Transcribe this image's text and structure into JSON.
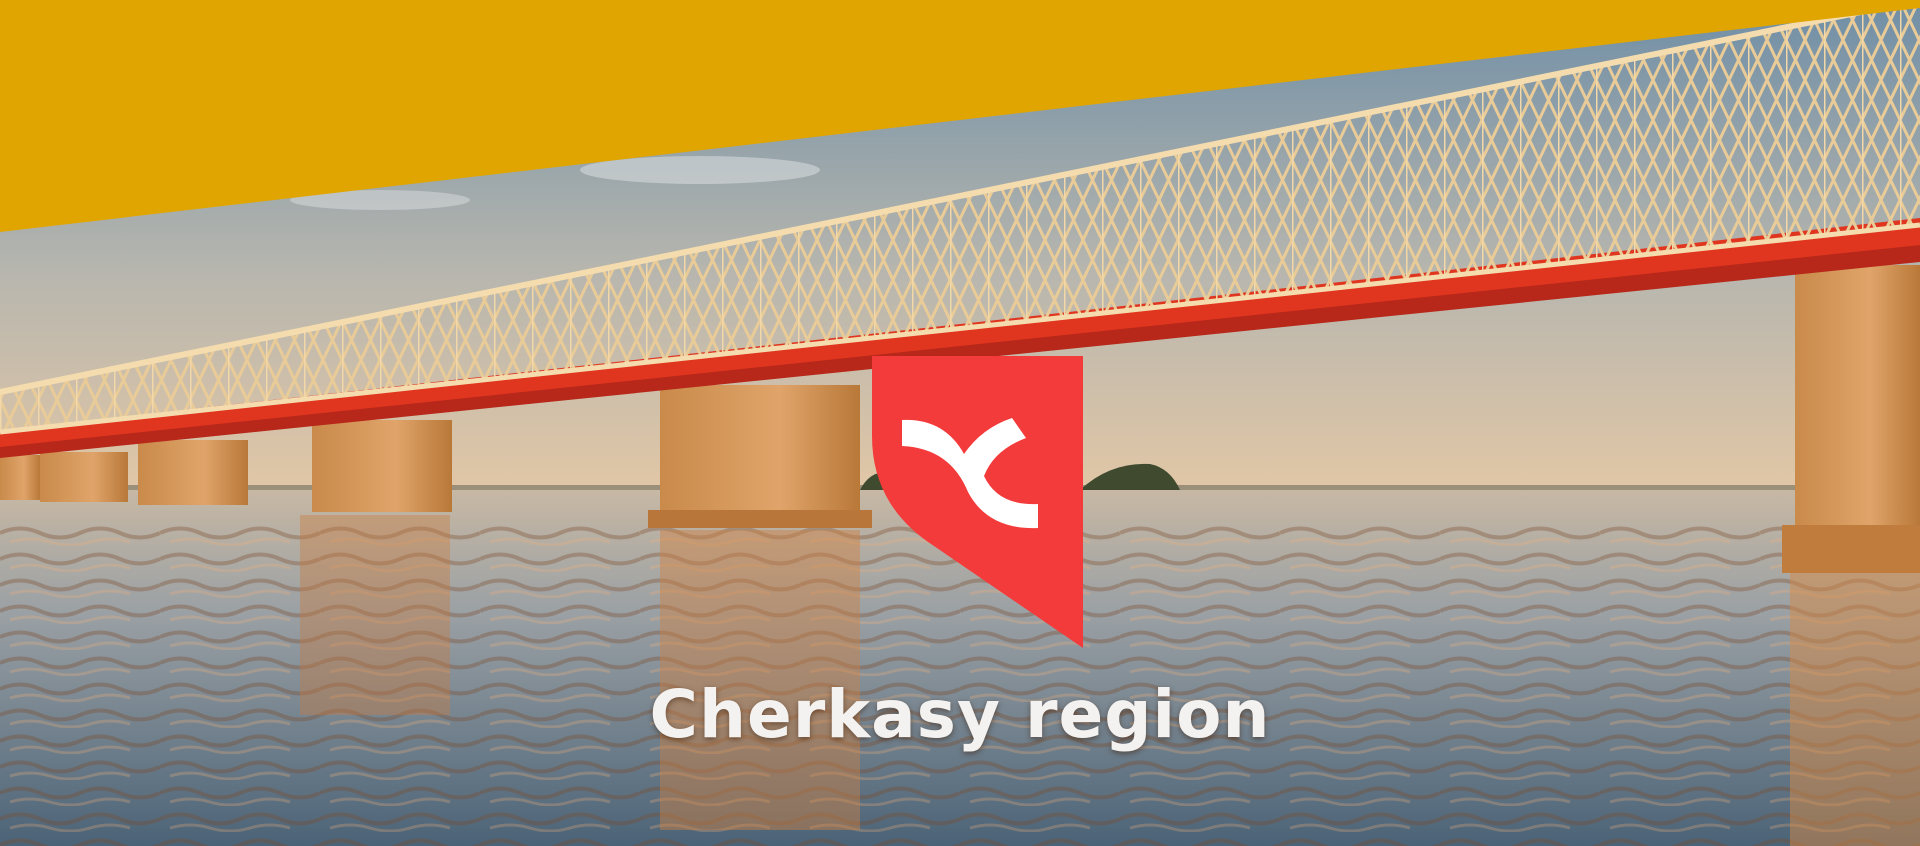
{
  "hero": {
    "title": "Cherkasy region"
  },
  "colors": {
    "banner": "#E0A500",
    "logo_red": "#F43B3B",
    "logo_mark": "#FFFFFF",
    "bridge_truss": "#E8C89A",
    "bridge_deck": "#E0361F"
  },
  "icons": {
    "logo": "cherkasy-region-logo-icon"
  }
}
